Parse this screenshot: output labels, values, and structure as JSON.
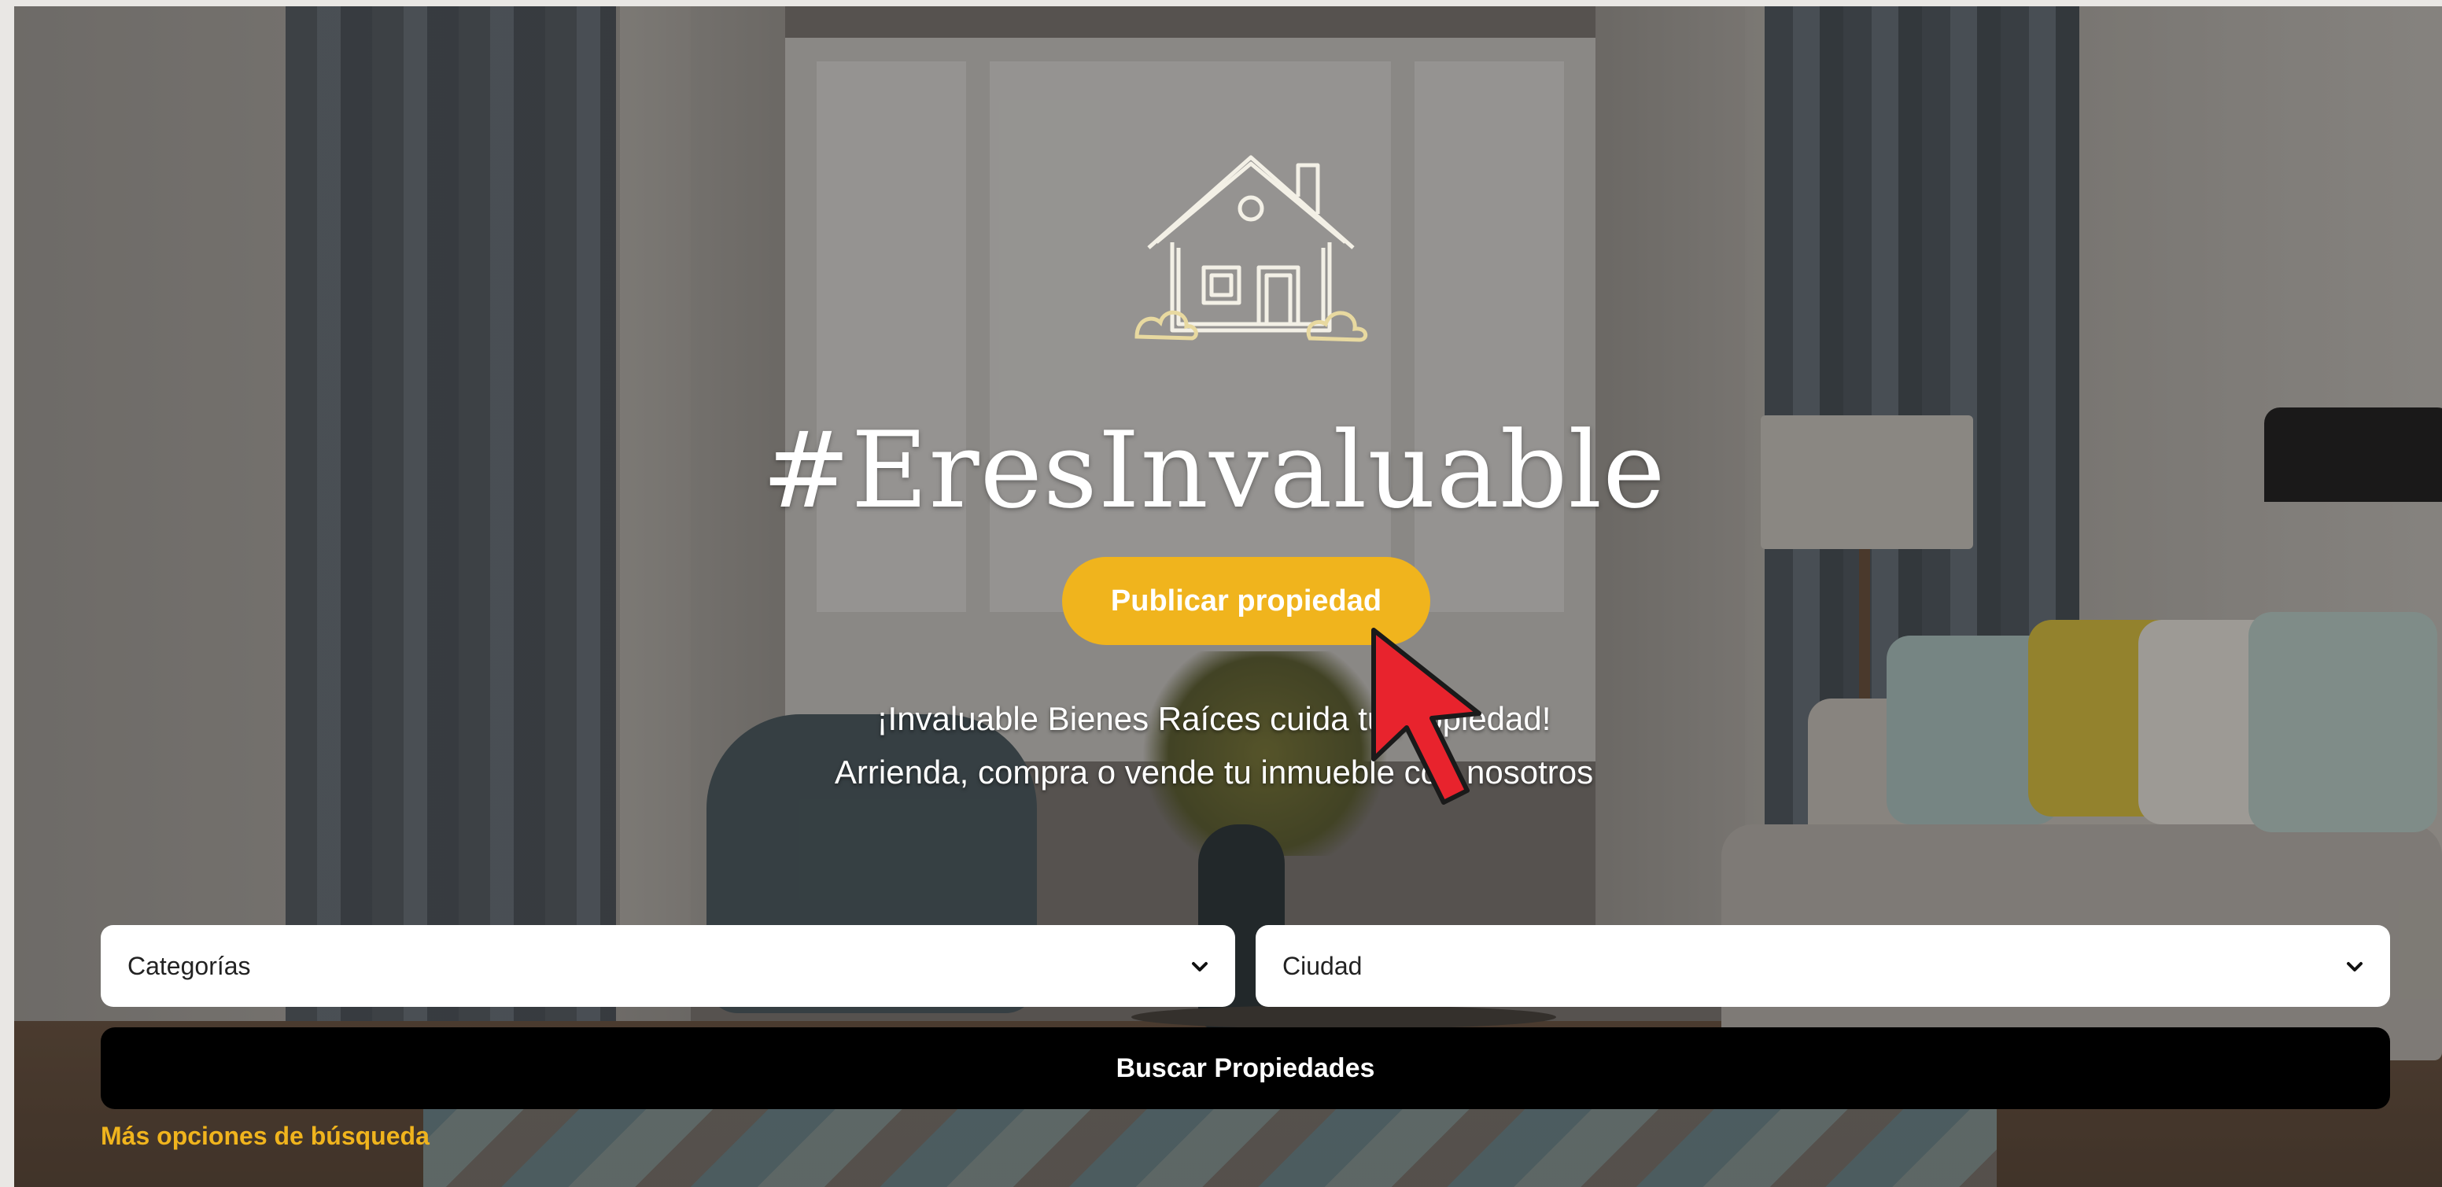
{
  "hero": {
    "headline": "#EresInvaluable",
    "publish_button": "Publicar propiedad",
    "tagline_line1": "¡Invaluable Bienes Raíces cuida tu propiedad!",
    "tagline_line2": "Arrienda, compra o vende tu inmueble con nosotros",
    "logo_icon": "house-icon",
    "accent_color": "#f0b41d"
  },
  "search": {
    "category_select": {
      "selected": "Categorías",
      "icon": "chevron-down-icon"
    },
    "city_select": {
      "selected": "Ciudad",
      "icon": "chevron-down-icon"
    },
    "search_button": "Buscar Propiedades",
    "more_options_link": "Más opciones de búsqueda"
  },
  "cursor": {
    "icon": "mouse-pointer-icon",
    "color": "#e8232d"
  }
}
